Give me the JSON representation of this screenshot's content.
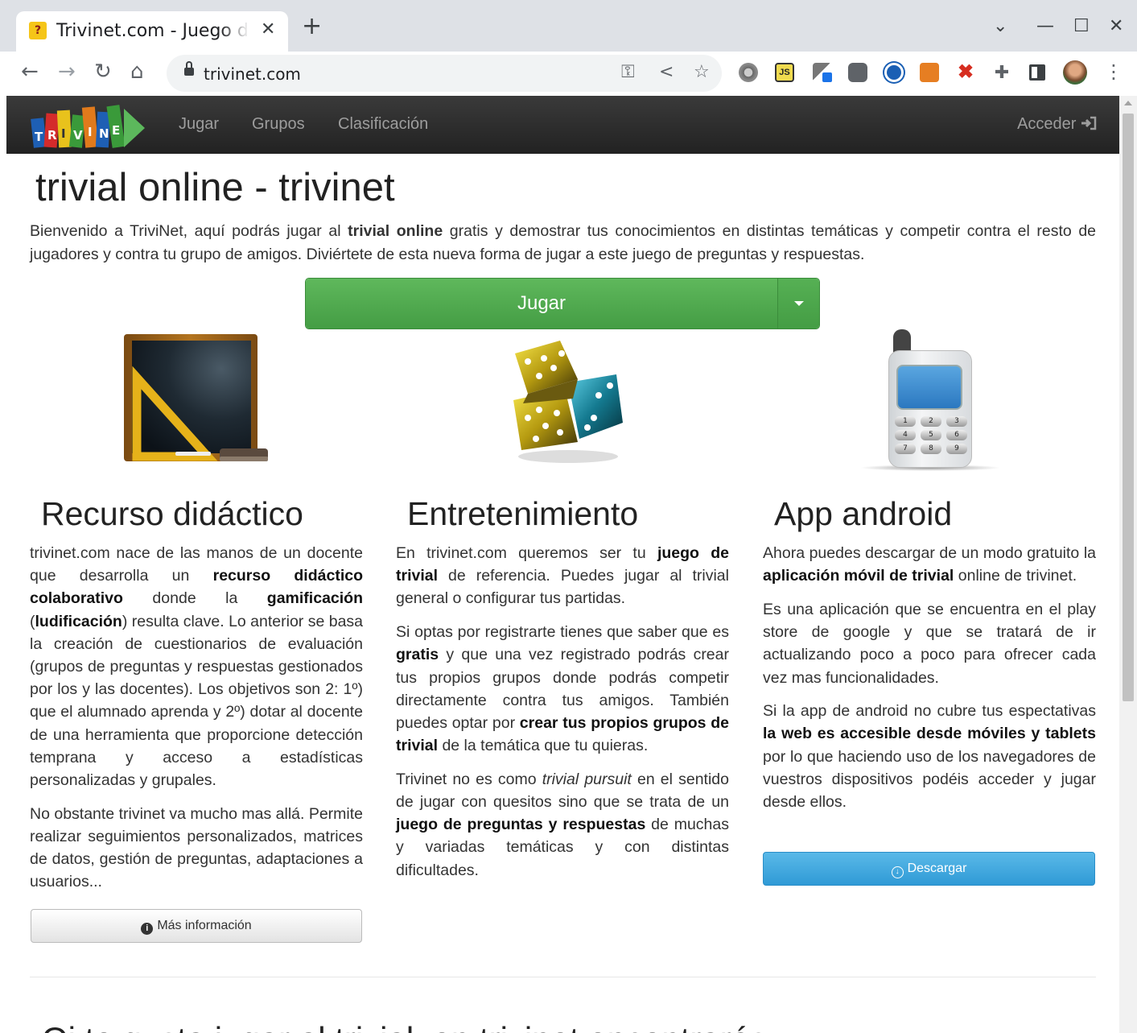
{
  "browser": {
    "tab_title": "Trivinet.com - Juego de trivial online",
    "tab_favicon": "?",
    "close_tab": "✕",
    "new_tab": "+",
    "url": "trivinet.com",
    "win_chevron": "⌄",
    "win_minimize": "—",
    "win_maximize": "☐",
    "win_close": "✕",
    "back": "←",
    "forward": "→",
    "reload": "↻",
    "home": "⌂",
    "key_icon": "⚿",
    "share_icon": "<",
    "star_icon": "☆",
    "menu_icon": "⋮",
    "extensions": [
      "gear-extension-icon",
      "js-extension-icon",
      "eyedropper-extension-icon",
      "reader-extension-icon",
      "soccer-extension-icon",
      "chart-extension-icon",
      "x-extension-icon",
      "puzzle-icon",
      "sidepanel-icon",
      "profile-avatar"
    ]
  },
  "navbar": {
    "logo_alt": "TRIVINET.com",
    "links": [
      "Jugar",
      "Grupos",
      "Clasificación"
    ],
    "login": "Acceder"
  },
  "main": {
    "title": "trivial online - trivinet",
    "intro_a": "Bienvenido a TriviNet, aquí podrás jugar al ",
    "intro_b": "trivial online",
    "intro_c": " gratis y demostrar tus conocimientos en distintas temáticas y competir contra el resto de jugadores y contra tu grupo de amigos. Diviértete de esta nueva forma de jugar a este juego de preguntas y respuestas.",
    "play_button": "Jugar"
  },
  "col1": {
    "title": "Recurso didáctico",
    "p1_a": "trivinet.com nace de las manos de un docente que desarrolla un ",
    "p1_b": "recurso didáctico colaborativo",
    "p1_c": " donde la ",
    "p1_d": "gamificación",
    "p1_e": " (",
    "p1_f": "ludificación",
    "p1_g": ") resulta clave. Lo anterior se basa la creación de cuestionarios de evaluación (grupos de preguntas y respuestas gestionados por los y las docentes). Los objetivos son 2: 1º) que el alumnado aprenda y 2º) dotar al docente de una herramienta que proporcione detección temprana y acceso a estadísticas personalizadas y grupales.",
    "p2": "No obstante trivinet va mucho mas allá. Permite realizar seguimientos personalizados, matrices de datos, gestión de preguntas, adaptaciones a usuarios...",
    "button": "Más información"
  },
  "col2": {
    "title": "Entretenimiento",
    "p1_a": "En trivinet.com queremos ser tu ",
    "p1_b": "juego de trivial",
    "p1_c": " de referencia. Puedes jugar al trivial general o configurar tus partidas.",
    "p2_a": "Si optas por registrarte tienes que saber que es ",
    "p2_b": "gratis",
    "p2_c": " y que una vez registrado podrás crear tus propios grupos donde podrás competir directamente contra tus amigos. También puedes optar por ",
    "p2_d": "crear tus propios grupos de trivial",
    "p2_e": " de la temática que tu quieras.",
    "p3_a": "Trivinet no es como ",
    "p3_b": "trivial pursuit",
    "p3_c": " en el sentido de jugar con quesitos sino que se trata de un ",
    "p3_d": "juego de preguntas y respuestas",
    "p3_e": " de muchas y variadas temáticas y con distintas dificultades."
  },
  "col3": {
    "title": "App android",
    "p1_a": "Ahora puedes descargar de un modo gratuito la ",
    "p1_b": "aplicación móvil de trivial",
    "p1_c": " online de trivinet.",
    "p2": "Es una aplicación que se encuentra en el play store de google y que se tratará de ir actualizando poco a poco para ofrecer cada vez mas funcionalidades.",
    "p3_a": "Si la app de android no cubre tus espectativas ",
    "p3_b": "la web es accesible desde móviles y tablets",
    "p3_c": " por lo que haciendo uso de los navegadores de vuestros dispositivos podéis acceder y jugar desde ellos.",
    "button": "Descargar"
  },
  "phone_keys": [
    "1",
    "2",
    "3",
    "4",
    "5",
    "6",
    "7",
    "8",
    "9"
  ],
  "next_section_title": "Qi te gusta jugar al trivial, en trivinet encontrarás...",
  "colors": {
    "navbar": "#222222",
    "play_green": "#449d44",
    "download_blue": "#2f9ad6"
  }
}
